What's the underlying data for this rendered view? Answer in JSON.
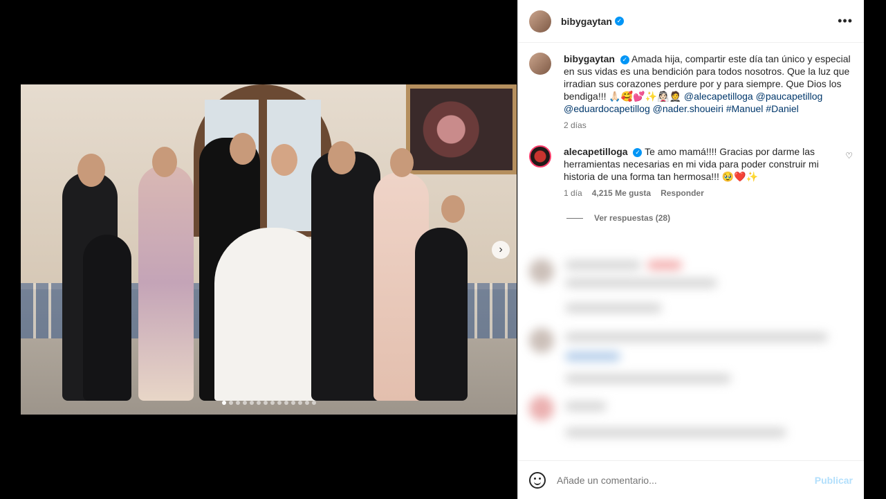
{
  "post": {
    "username": "bibygaytan",
    "verified": true,
    "more_icon": "more-horizontal-icon"
  },
  "caption": {
    "username": "bibygaytan",
    "text": "Amada hija, compartir este día tan único y especial en sus vidas es una bendición para todos nosotros. Que la luz que irradian sus corazones perdure por y para siempre. Que Dios los bendiga!!! 🙏🏻🥰💕✨👰🏻🤵",
    "mentions": [
      "@alecapetilloga",
      "@paucapetillog",
      "@eduardocapetillog",
      "@nader.shoueiri",
      "#Manuel",
      "#Daniel"
    ],
    "time": "2 días"
  },
  "comment": {
    "username": "alecapetilloga",
    "verified": true,
    "text": "Te amo mamá!!!! Gracias por darme las herramientas necesarias en mi vida para poder construir mi historia de una forma tan hermosa!!! 🥹❤️✨",
    "time": "1 día",
    "likes": "4,215 Me gusta",
    "reply_label": "Responder",
    "view_replies": "Ver respuestas (28)"
  },
  "footer": {
    "placeholder": "Añade un comentario...",
    "post_label": "Publicar"
  },
  "carousel": {
    "total_slides": 14,
    "active_index": 0
  },
  "colors": {
    "link": "#00376b",
    "verified": "#0095f6",
    "post_disabled": "#b2dffc"
  }
}
